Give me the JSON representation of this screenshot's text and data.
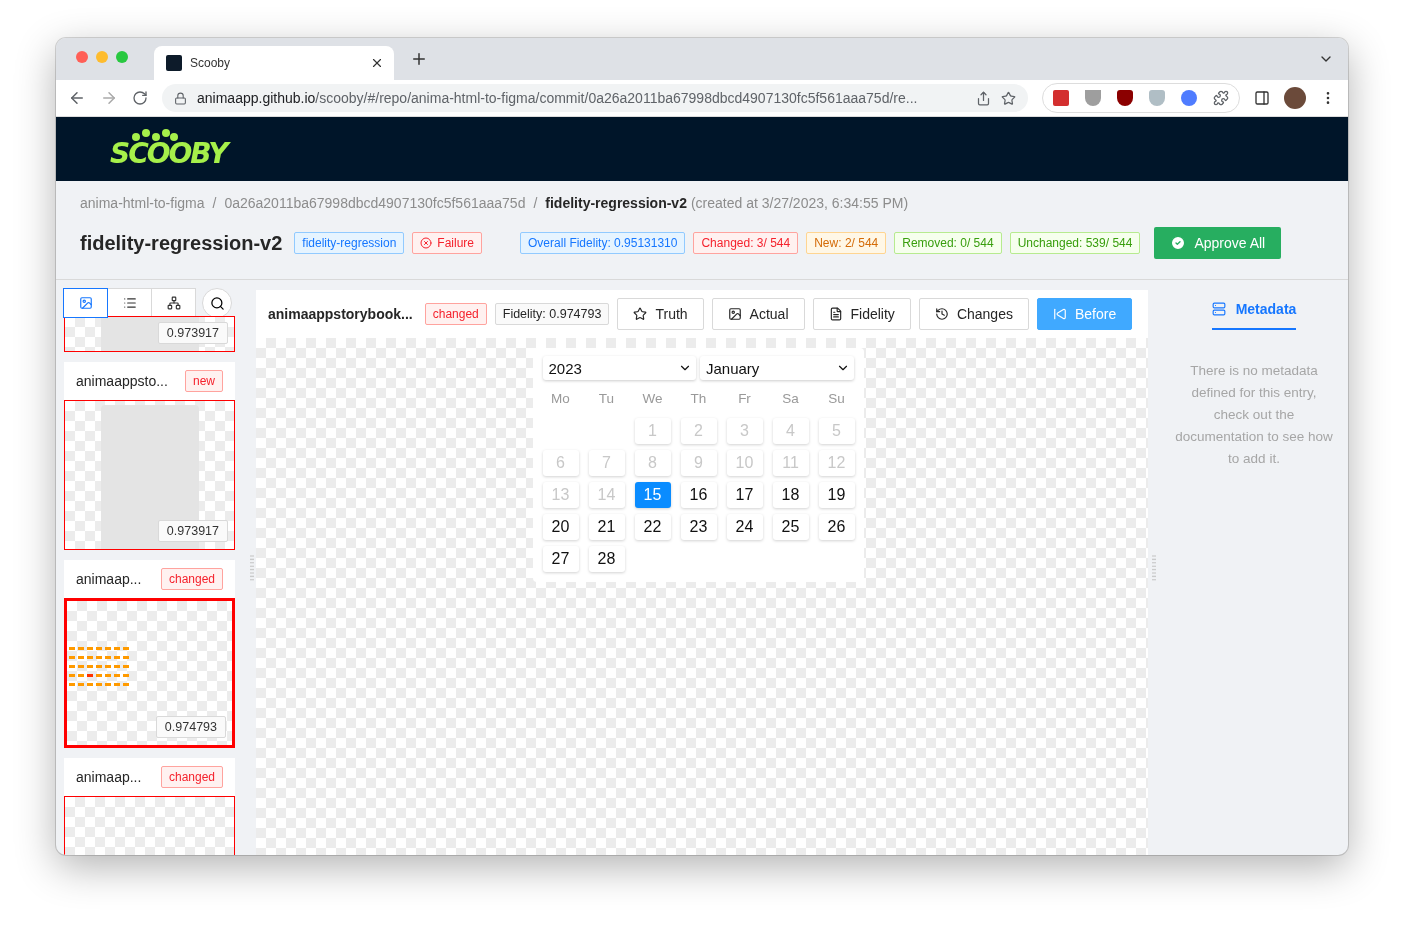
{
  "browser": {
    "tab_title": "Scooby",
    "url_host": "animaapp.github.io",
    "url_path": "/scooby/#/repo/anima-html-to-figma/commit/0a26a2011ba67998dbcd4907130fc5f561aaa75d/re..."
  },
  "app": {
    "logo": "SCOOBY"
  },
  "breadcrumb": [
    {
      "kind": "link",
      "label": "anima-html-to-figma"
    },
    {
      "kind": "separator",
      "label": "/"
    },
    {
      "kind": "link",
      "label": "0a26a2011ba67998dbcd4907130fc5f561aaa75d"
    },
    {
      "kind": "separator",
      "label": "/"
    },
    {
      "kind": "current",
      "label": "fidelity-regression-v2"
    },
    {
      "kind": "note",
      "label": "(created at 3/27/2023, 6:34:55 PM)"
    }
  ],
  "title": "fidelity-regression-v2",
  "tags": [
    {
      "label": "fidelity-regression",
      "kind": "info",
      "icon": false
    },
    {
      "label": "Failure",
      "kind": "error",
      "icon": true
    }
  ],
  "stats": [
    {
      "label": "Overall Fidelity: 0.95131310",
      "kind": "info"
    },
    {
      "label": "Changed: 3/ 544",
      "kind": "error"
    },
    {
      "label": "New: 2/ 544",
      "kind": "warning"
    },
    {
      "label": "Removed: 0/ 544",
      "kind": "success"
    },
    {
      "label": "Unchanged: 539/ 544",
      "kind": "success"
    }
  ],
  "approve_button": "Approve All",
  "view_modes": [
    {
      "kind": "image",
      "selected": true
    },
    {
      "kind": "list",
      "selected": false
    },
    {
      "kind": "tree",
      "selected": false
    }
  ],
  "entries": [
    {
      "kind": "partial",
      "thumbnail": {
        "kind": "widget"
      },
      "score": "0.973917",
      "selected": false
    },
    {
      "kind": "full",
      "title": "animaappsto...",
      "status": "new",
      "thumbnail": {
        "kind": "widget"
      },
      "score": "0.973917",
      "selected": false
    },
    {
      "kind": "full",
      "title": "animaap...",
      "status": "changed",
      "thumbnail": {
        "kind": "calendar"
      },
      "score": "0.974793",
      "selected": true
    },
    {
      "kind": "full",
      "title": "animaap...",
      "status": "changed",
      "thumbnail": {
        "kind": "blank"
      },
      "selected": false
    }
  ],
  "viewer": {
    "name": "animaappstorybook...",
    "status": "changed",
    "fidelity": "Fidelity: 0.974793",
    "modes": [
      {
        "kind": "truth",
        "label": "Truth",
        "selected": false
      },
      {
        "kind": "actual",
        "label": "Actual",
        "selected": false
      },
      {
        "kind": "fidelity",
        "label": "Fidelity",
        "selected": false
      },
      {
        "kind": "changes",
        "label": "Changes",
        "selected": false
      },
      {
        "kind": "before",
        "label": "Before",
        "selected": true
      }
    ]
  },
  "calendar": {
    "year": "2023",
    "month": "January",
    "weekdays": [
      "Mo",
      "Tu",
      "We",
      "Th",
      "Fr",
      "Sa",
      "Su"
    ],
    "weeks": [
      [
        {
          "kind": "blank"
        },
        {
          "kind": "blank"
        },
        {
          "kind": "day",
          "label": "1",
          "disabled": true,
          "selected": false
        },
        {
          "kind": "day",
          "label": "2",
          "disabled": true,
          "selected": false
        },
        {
          "kind": "day",
          "label": "3",
          "disabled": true,
          "selected": false
        },
        {
          "kind": "day",
          "label": "4",
          "disabled": true,
          "selected": false
        },
        {
          "kind": "day",
          "label": "5",
          "disabled": true,
          "selected": false
        }
      ],
      [
        {
          "kind": "day",
          "label": "6",
          "disabled": true,
          "selected": false
        },
        {
          "kind": "day",
          "label": "7",
          "disabled": true,
          "selected": false
        },
        {
          "kind": "day",
          "label": "8",
          "disabled": true,
          "selected": false
        },
        {
          "kind": "day",
          "label": "9",
          "disabled": true,
          "selected": false
        },
        {
          "kind": "day",
          "label": "10",
          "disabled": true,
          "selected": false
        },
        {
          "kind": "day",
          "label": "11",
          "disabled": true,
          "selected": false
        },
        {
          "kind": "day",
          "label": "12",
          "disabled": true,
          "selected": false
        }
      ],
      [
        {
          "kind": "day",
          "label": "13",
          "disabled": true,
          "selected": false
        },
        {
          "kind": "day",
          "label": "14",
          "disabled": true,
          "selected": false
        },
        {
          "kind": "day",
          "label": "15",
          "disabled": false,
          "selected": true
        },
        {
          "kind": "day",
          "label": "16",
          "disabled": false,
          "selected": false
        },
        {
          "kind": "day",
          "label": "17",
          "disabled": false,
          "selected": false
        },
        {
          "kind": "day",
          "label": "18",
          "disabled": false,
          "selected": false
        },
        {
          "kind": "day",
          "label": "19",
          "disabled": false,
          "selected": false
        }
      ],
      [
        {
          "kind": "day",
          "label": "20",
          "disabled": false,
          "selected": false
        },
        {
          "kind": "day",
          "label": "21",
          "disabled": false,
          "selected": false
        },
        {
          "kind": "day",
          "label": "22",
          "disabled": false,
          "selected": false
        },
        {
          "kind": "day",
          "label": "23",
          "disabled": false,
          "selected": false
        },
        {
          "kind": "day",
          "label": "24",
          "disabled": false,
          "selected": false
        },
        {
          "kind": "day",
          "label": "25",
          "disabled": false,
          "selected": false
        },
        {
          "kind": "day",
          "label": "26",
          "disabled": false,
          "selected": false
        }
      ],
      [
        {
          "kind": "day",
          "label": "27",
          "disabled": false,
          "selected": false
        },
        {
          "kind": "day",
          "label": "28",
          "disabled": false,
          "selected": false
        }
      ]
    ]
  },
  "metadata": {
    "tab": "Metadata",
    "empty_text": "There is no metadata defined for this entry, check out the documentation to see how to add it."
  }
}
